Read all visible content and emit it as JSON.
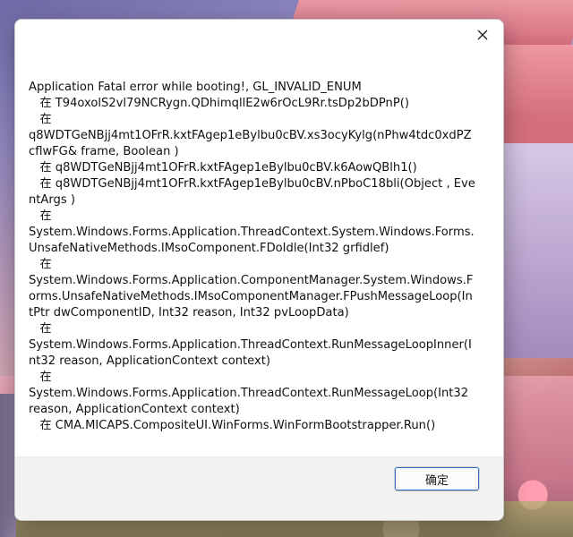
{
  "dialog": {
    "close_icon": "close-icon",
    "message_lines": [
      "Application Fatal error while booting!, GL_INVALID_ENUM",
      "   在 T94oxolS2vl79NCRygn.QDhimqllE2w6rOcL9Rr.tsDp2bDPnP()",
      "   在",
      "q8WDTGeNBjj4mt1OFrR.kxtFAgep1eBylbu0cBV.xs3ocyKylg(nPhw4tdc0xdPZcflwFG& frame, Boolean )",
      "   在 q8WDTGeNBjj4mt1OFrR.kxtFAgep1eBylbu0cBV.k6AowQBlh1()",
      "   在 q8WDTGeNBjj4mt1OFrR.kxtFAgep1eBylbu0cBV.nPboC18bli(Object , EventArgs )",
      "   在",
      "System.Windows.Forms.Application.ThreadContext.System.Windows.Forms.UnsafeNativeMethods.IMsoComponent.FDoIdle(Int32 grfidlef)",
      "   在",
      "System.Windows.Forms.Application.ComponentManager.System.Windows.Forms.UnsafeNativeMethods.IMsoComponentManager.FPushMessageLoop(IntPtr dwComponentID, Int32 reason, Int32 pvLoopData)",
      "   在",
      "System.Windows.Forms.Application.ThreadContext.RunMessageLoopInner(Int32 reason, ApplicationContext context)",
      "   在",
      "System.Windows.Forms.Application.ThreadContext.RunMessageLoop(Int32 reason, ApplicationContext context)",
      "   在 CMA.MICAPS.CompositeUI.WinForms.WinFormBootstrapper.Run()"
    ],
    "ok_label": "确定"
  },
  "colors": {
    "dialog_bg": "#ffffff",
    "footer_bg": "#f2f2f2",
    "button_focus_border": "#2f6fc9"
  }
}
